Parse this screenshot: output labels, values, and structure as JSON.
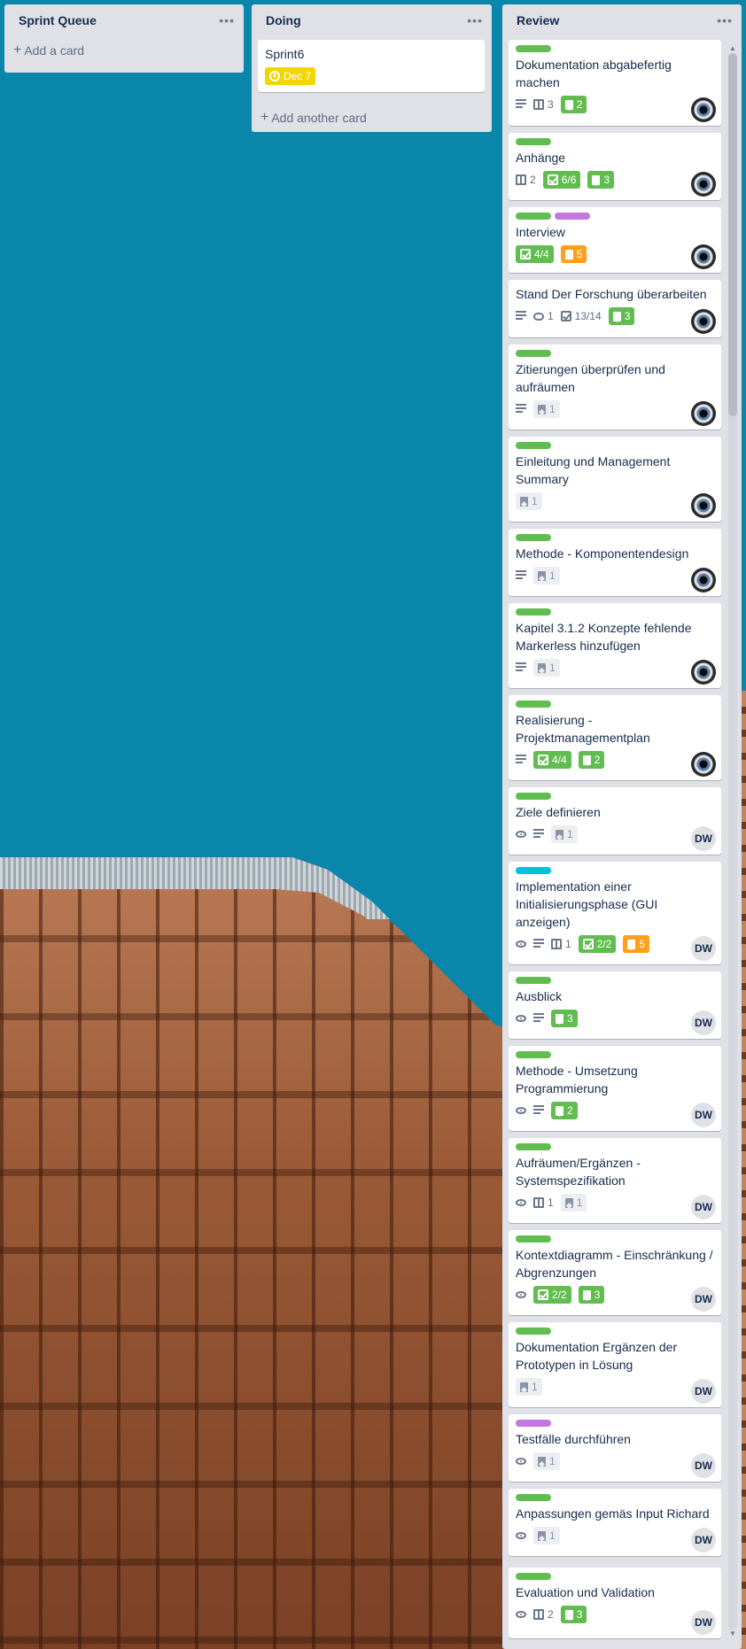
{
  "colors": {
    "green": "#61bd4f",
    "purple": "#c377e0",
    "sky": "#00c2e0",
    "orange": "#ff9f1a",
    "yellow": "#f2d600",
    "board_background": "#0a86ab"
  },
  "lists": [
    {
      "title": "Sprint Queue",
      "add_label": "Add a card",
      "cards": []
    },
    {
      "title": "Doing",
      "add_label": "Add another card",
      "cards": [
        {
          "title": "Sprint6",
          "due": "Dec 7"
        }
      ]
    },
    {
      "title": "Review",
      "cards": [
        {
          "title": "Dokumentation abgabefertig machen",
          "labels": [
            "green"
          ],
          "badges": [
            "description",
            "board:3",
            "tag-green:2"
          ],
          "avatar": "eye-avatar"
        },
        {
          "title": "Anhänge",
          "labels": [
            "green"
          ],
          "badges": [
            "board:2",
            "check-green:6/6",
            "tag-green:3"
          ],
          "avatar": "eye-avatar"
        },
        {
          "title": "Interview",
          "labels": [
            "green",
            "purple"
          ],
          "badges": [
            "check-green:4/4",
            "tag-orange:5"
          ],
          "avatar": "eye-avatar"
        },
        {
          "title": "Stand Der Forschung überarbeiten",
          "labels": [],
          "badges": [
            "description",
            "comment:1",
            "check:13/14",
            "tag-green:3"
          ],
          "avatar": "eye-avatar"
        },
        {
          "title": "Zitierungen überprüfen und aufräumen",
          "labels": [
            "green"
          ],
          "badges": [
            "description",
            "tag-grey:1"
          ],
          "avatar": "eye-avatar"
        },
        {
          "title": "Einleitung und Management Summary",
          "labels": [
            "green"
          ],
          "badges": [
            "tag-grey:1"
          ],
          "avatar": "eye-avatar"
        },
        {
          "title": "Methode - Komponentendesign",
          "labels": [
            "green"
          ],
          "badges": [
            "description",
            "tag-grey:1"
          ],
          "avatar": "eye-avatar"
        },
        {
          "title": "Kapitel 3.1.2 Konzepte fehlende Markerless hinzufügen",
          "labels": [
            "green"
          ],
          "badges": [
            "description",
            "tag-grey:1"
          ],
          "avatar": "eye-avatar"
        },
        {
          "title": "Realisierung - Projektmanagementplan",
          "labels": [
            "green"
          ],
          "badges": [
            "description",
            "check-green:4/4",
            "tag-green:2"
          ],
          "avatar": "eye-avatar"
        },
        {
          "title": "Ziele definieren",
          "labels": [
            "green"
          ],
          "badges": [
            "watch",
            "description",
            "tag-grey:1"
          ],
          "avatar": "DW"
        },
        {
          "title": "Implementation einer Initialisierungsphase (GUI anzeigen)",
          "labels": [
            "sky"
          ],
          "badges": [
            "watch",
            "description",
            "board:1",
            "check-green:2/2",
            "tag-orange:5"
          ],
          "avatar": "DW"
        },
        {
          "title": "Ausblick",
          "labels": [
            "green"
          ],
          "badges": [
            "watch",
            "description",
            "tag-green:3"
          ],
          "avatar": "DW"
        },
        {
          "title": "Methode - Umsetzung Programmierung",
          "labels": [
            "green"
          ],
          "badges": [
            "watch",
            "description",
            "tag-green:2"
          ],
          "avatar": "DW"
        },
        {
          "title": "Aufräumen/Ergänzen - Systemspezifikation",
          "labels": [
            "green"
          ],
          "badges": [
            "watch",
            "board:1",
            "tag-grey:1"
          ],
          "avatar": "DW"
        },
        {
          "title": "Kontextdiagramm - Einschränkung / Abgrenzungen",
          "labels": [
            "green"
          ],
          "badges": [
            "watch",
            "check-green:2/2",
            "tag-green:3"
          ],
          "avatar": "DW"
        },
        {
          "title": "Dokumentation Ergänzen der Prototypen in Lösung",
          "labels": [
            "green"
          ],
          "badges": [
            "tag-grey:1"
          ],
          "avatar": "DW"
        },
        {
          "title": "Testfälle durchführen",
          "labels": [
            "purple"
          ],
          "badges": [
            "watch",
            "tag-grey:1"
          ],
          "avatar": "DW"
        },
        {
          "title": "Anpassungen gemäs Input Richard",
          "labels": [
            "green"
          ],
          "badges": [
            "watch",
            "tag-grey:1"
          ],
          "avatar": "DW"
        },
        {
          "title": "Evaluation und Validation",
          "labels": [
            "green"
          ],
          "badges": [
            "watch",
            "board:2",
            "tag-green:3"
          ],
          "avatar": "DW"
        }
      ]
    }
  ]
}
